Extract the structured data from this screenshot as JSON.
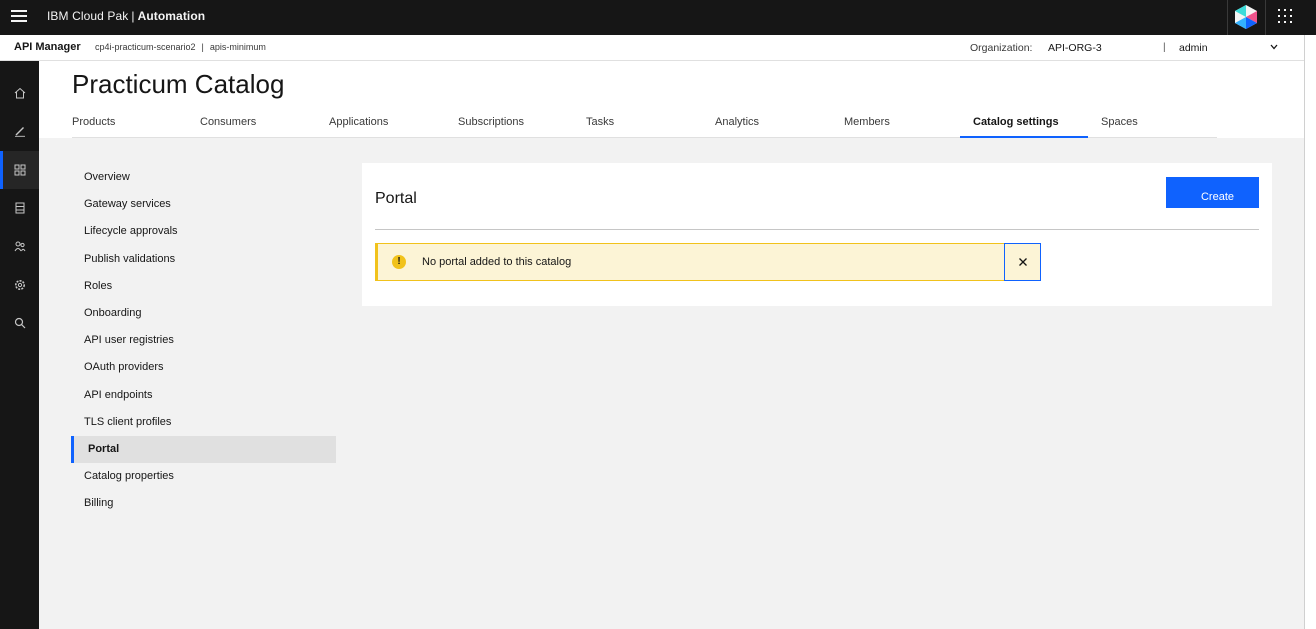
{
  "topbar": {
    "brand_prefix": "IBM Cloud Pak",
    "brand_sep": "|",
    "brand_product": "Automation"
  },
  "subbar": {
    "product": "API Manager",
    "breadcrumbs": [
      "cp4i-practicum-scenario2",
      "apis-minimum"
    ],
    "breadcrumb_sep": "|",
    "org_label": "Organization:",
    "org_value": "API-ORG-3",
    "pipe": "|",
    "user": "admin"
  },
  "rail": {
    "items": [
      {
        "icon": "home-icon"
      },
      {
        "icon": "edit-icon"
      },
      {
        "icon": "grid-icon",
        "active": true
      },
      {
        "icon": "database-icon"
      },
      {
        "icon": "members-icon"
      },
      {
        "icon": "settings-icon"
      },
      {
        "icon": "search-icon"
      }
    ]
  },
  "page": {
    "title": "Practicum Catalog"
  },
  "tabs": [
    {
      "label": "Products"
    },
    {
      "label": "Consumers"
    },
    {
      "label": "Applications"
    },
    {
      "label": "Subscriptions"
    },
    {
      "label": "Tasks"
    },
    {
      "label": "Analytics"
    },
    {
      "label": "Members"
    },
    {
      "label": "Catalog settings",
      "active": true
    },
    {
      "label": "Spaces"
    }
  ],
  "sidenav": {
    "items": [
      {
        "label": "Overview"
      },
      {
        "label": "Gateway services"
      },
      {
        "label": "Lifecycle approvals"
      },
      {
        "label": "Publish validations"
      },
      {
        "label": "Roles"
      },
      {
        "label": "Onboarding"
      },
      {
        "label": "API user registries"
      },
      {
        "label": "OAuth providers"
      },
      {
        "label": "API endpoints"
      },
      {
        "label": "TLS client profiles"
      },
      {
        "label": "Portal",
        "active": true
      },
      {
        "label": "Catalog properties"
      },
      {
        "label": "Billing"
      }
    ]
  },
  "card": {
    "title": "Portal",
    "create_label": "Create",
    "notice": {
      "icon": "warning-icon",
      "glyph": "!",
      "message": "No portal added to this catalog"
    }
  },
  "colors": {
    "accent": "#0f62fe",
    "shell": "#161616",
    "warning": "#f1c21b",
    "warning_bg": "#fcf4d6"
  }
}
